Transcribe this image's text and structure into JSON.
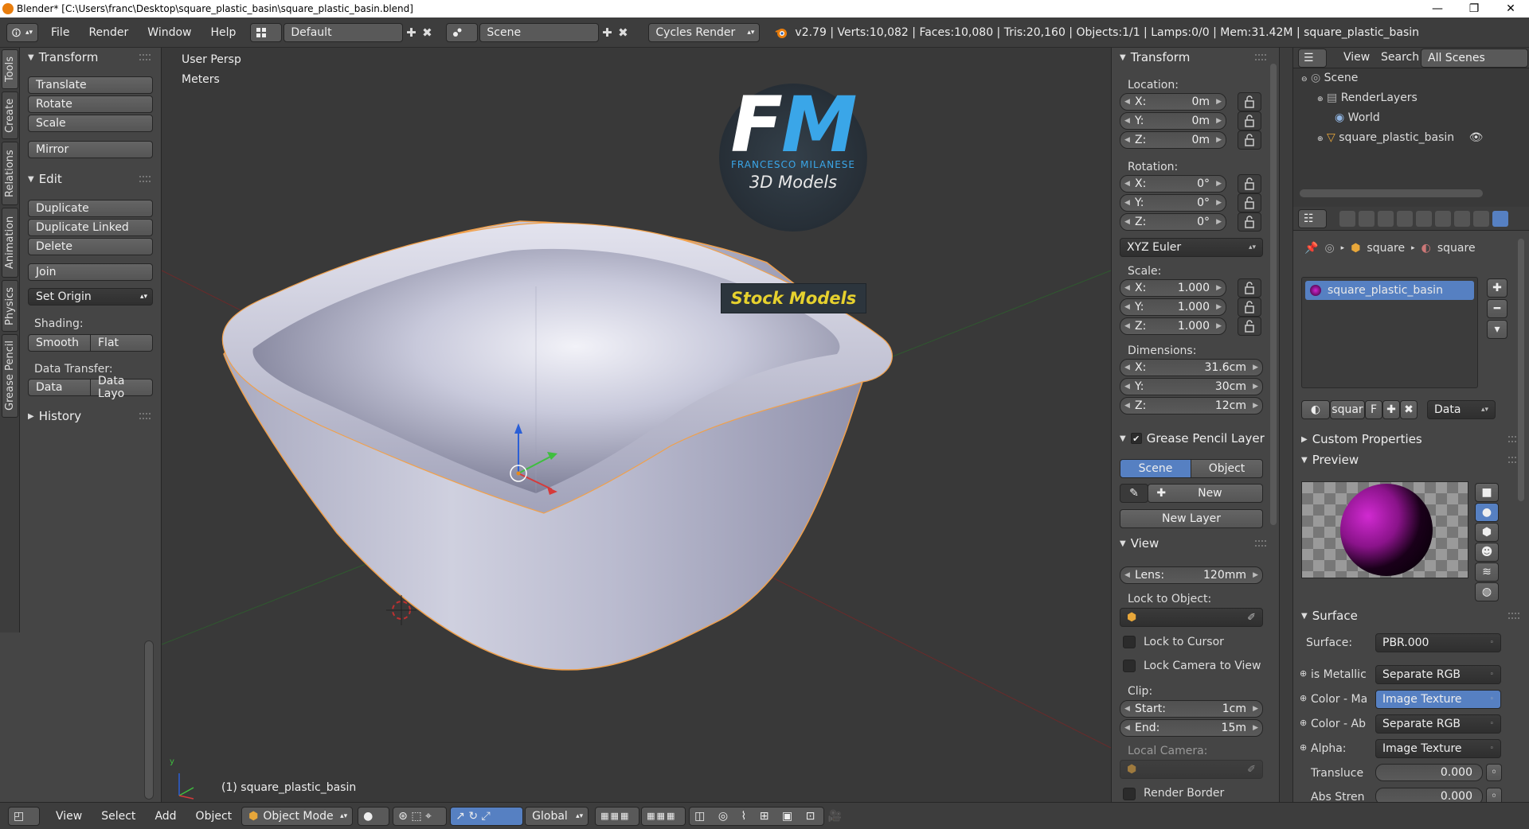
{
  "window": {
    "title": "Blender* [C:\\Users\\franc\\Desktop\\square_plastic_basin\\square_plastic_basin.blend]",
    "controls": [
      "—",
      "❐",
      "✕"
    ]
  },
  "infobar": {
    "menus": [
      "File",
      "Render",
      "Window",
      "Help"
    ],
    "layout": "Default",
    "scene": "Scene",
    "engine": "Cycles Render",
    "stats": "v2.79 | Verts:10,082 | Faces:10,080 | Tris:20,160 | Objects:1/1 | Lamps:0/0 | Mem:31.42M | square_plastic_basin"
  },
  "tabs": [
    "Tools",
    "Create",
    "Relations",
    "Animation",
    "Physics",
    "Grease Pencil"
  ],
  "toolshelf": {
    "transform": {
      "title": "Transform",
      "buttons": [
        "Translate",
        "Rotate",
        "Scale",
        "Mirror"
      ]
    },
    "edit": {
      "title": "Edit",
      "buttons": [
        "Duplicate",
        "Duplicate Linked",
        "Delete",
        "Join"
      ],
      "set_origin": "Set Origin",
      "shading_label": "Shading:",
      "smooth": "Smooth",
      "flat": "Flat",
      "data_transfer_label": "Data Transfer:",
      "data": "Data",
      "data_layout": "Data Layo"
    },
    "history": "History"
  },
  "viewport": {
    "view_name": "User Persp",
    "units": "Meters",
    "object_label": "(1) square_plastic_basin",
    "logo": {
      "letters": "FM",
      "company": "FRANCESCO MILANESE",
      "subtitle": "3D Models",
      "banner": "Stock Models"
    }
  },
  "npanel": {
    "title": "Transform",
    "location_label": "Location:",
    "location": [
      {
        "axis": "X:",
        "value": "0m"
      },
      {
        "axis": "Y:",
        "value": "0m"
      },
      {
        "axis": "Z:",
        "value": "0m"
      }
    ],
    "rotation_label": "Rotation:",
    "rotation": [
      {
        "axis": "X:",
        "value": "0°"
      },
      {
        "axis": "Y:",
        "value": "0°"
      },
      {
        "axis": "Z:",
        "value": "0°"
      }
    ],
    "rotation_mode": "XYZ Euler",
    "scale_label": "Scale:",
    "scale": [
      {
        "axis": "X:",
        "value": "1.000"
      },
      {
        "axis": "Y:",
        "value": "1.000"
      },
      {
        "axis": "Z:",
        "value": "1.000"
      }
    ],
    "dimensions_label": "Dimensions:",
    "dimensions": [
      {
        "axis": "X:",
        "value": "31.6cm"
      },
      {
        "axis": "Y:",
        "value": "30cm"
      },
      {
        "axis": "Z:",
        "value": "12cm"
      }
    ],
    "grease_pencil": {
      "title": "Grease Pencil Layer",
      "scene": "Scene",
      "object": "Object",
      "new": "New",
      "new_layer": "New Layer"
    },
    "view": {
      "title": "View",
      "lens_label": "Lens:",
      "lens": "120mm",
      "lock_to_object": "Lock to Object:",
      "lock_to_cursor": "Lock to Cursor",
      "lock_camera": "Lock Camera to View",
      "clip_label": "Clip:",
      "start_label": "Start:",
      "start": "1cm",
      "end_label": "End:",
      "end": "15m",
      "local_camera": "Local Camera:",
      "render_border": "Render Border"
    }
  },
  "outliner": {
    "menus": [
      "View",
      "Search"
    ],
    "filter": "All Scenes",
    "items": [
      "Scene",
      "RenderLayers",
      "World",
      "square_plastic_basin"
    ]
  },
  "properties": {
    "breadcrumb": [
      "square",
      "square"
    ],
    "material_slot": "square_plastic_basin",
    "material_name": "squar",
    "f_label": "F",
    "link": "Data",
    "custom_properties": "Custom Properties",
    "preview": "Preview",
    "surface_title": "Surface",
    "surface_label": "Surface:",
    "surface_value": "PBR.000",
    "inputs": [
      {
        "label": "is Metallic",
        "value": "Separate RGB"
      },
      {
        "label": "Color - Ma",
        "value": "Image Texture"
      },
      {
        "label": "Color - Ab",
        "value": "Separate RGB"
      },
      {
        "label": "Alpha:",
        "value": "Image Texture"
      }
    ],
    "translucent_label": "Transluce",
    "translucent_value": "0.000",
    "abs_label": "Abs Stren",
    "abs_value": "0.000"
  },
  "bottombar": {
    "menus": [
      "View",
      "Select",
      "Add",
      "Object"
    ],
    "mode": "Object Mode",
    "orientation": "Global"
  },
  "colors": {
    "accent": "#5680c2",
    "orange_select": "#f1a04a",
    "logo_blue": "#3aa6e8",
    "logo_yellow": "#e6d12e"
  }
}
